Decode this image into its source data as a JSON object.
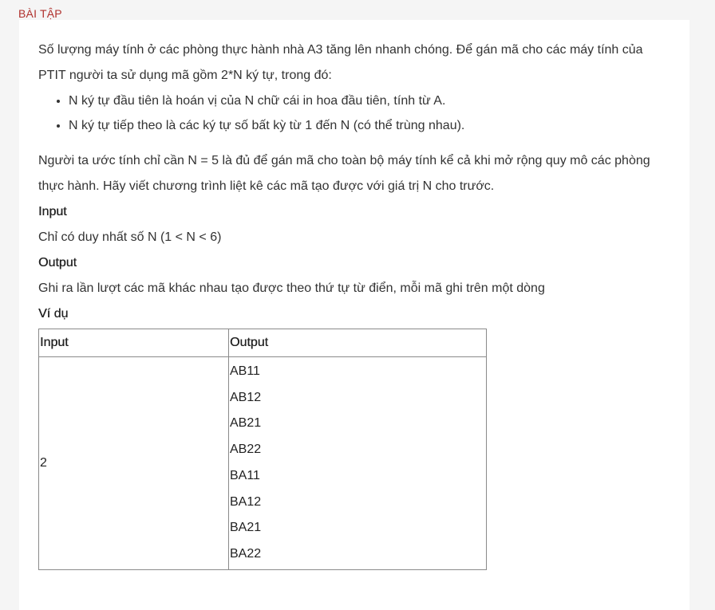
{
  "section_label": "BÀI TẬP",
  "problem": {
    "intro": "Số lượng máy tính ở các phòng thực hành nhà A3 tăng lên nhanh chóng. Để gán mã cho các máy tính của PTIT người ta sử dụng mã gồm 2*N ký tự, trong đó:",
    "bullets": [
      "N ký tự đầu tiên là hoán vị của N chữ cái in hoa đầu tiên, tính từ A.",
      "N ký tự tiếp theo là các ký tự số bất kỳ từ 1 đến N (có thể trùng nhau)."
    ],
    "task": "Người ta ước tính chỉ cần N = 5 là đủ để gán mã cho toàn bộ máy tính kể cả khi mở rộng quy mô các phòng thực hành. Hãy viết chương trình liệt kê các mã tạo được với giá trị N cho trước.",
    "input_heading": "Input",
    "input_text": "Chỉ có duy nhất số N (1 < N < 6)",
    "output_heading": "Output",
    "output_text": "Ghi ra lần lượt các mã khác nhau tạo được theo thứ tự từ điển, mỗi mã ghi trên một dòng",
    "example_heading": "Ví dụ"
  },
  "example_table": {
    "headers": [
      "Input",
      "Output"
    ],
    "input": "2",
    "output": [
      "AB11",
      "AB12",
      "AB21",
      "AB22",
      "BA11",
      "BA12",
      "BA21",
      "BA22"
    ]
  }
}
